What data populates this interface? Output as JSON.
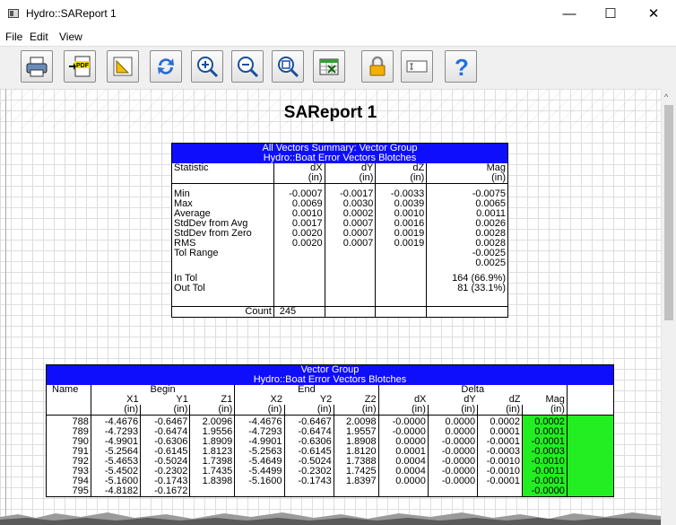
{
  "window": {
    "title": "Hydro::SAReport 1",
    "minimize": "—",
    "maximize": "☐",
    "close": "✕"
  },
  "menu": [
    "File",
    "Edit",
    "View"
  ],
  "toolbar": [
    "print-icon",
    "export-pdf-icon",
    "measure-icon",
    "refresh-icon",
    "zoom-in-icon",
    "zoom-out-icon",
    "zoom-fit-icon",
    "export-excel-icon",
    "lock-icon",
    "text-field-icon",
    "help-icon"
  ],
  "report": {
    "title": "SAReport 1"
  },
  "summary": {
    "title1": "All Vectors Summary: Vector Group",
    "title2": "Hydro::Boat Error  Vectors  Blotches",
    "headers": [
      "Statistic",
      "dX",
      "dY",
      "dZ",
      "Mag"
    ],
    "units": [
      "",
      "(in)",
      "(in)",
      "(in)",
      "(in)"
    ],
    "rows": [
      [
        "Min",
        "-0.0007",
        "-0.0017",
        "-0.0033",
        "-0.0075"
      ],
      [
        "Max",
        "0.0069",
        "0.0030",
        "0.0039",
        "0.0065"
      ],
      [
        "Average",
        "0.0010",
        "0.0002",
        "0.0010",
        "0.0011"
      ],
      [
        "StdDev from Avg",
        "0.0017",
        "0.0007",
        "0.0016",
        "0.0026"
      ],
      [
        "StdDev from Zero",
        "0.0020",
        "0.0007",
        "0.0019",
        "0.0028"
      ],
      [
        "RMS",
        "0.0020",
        "0.0007",
        "0.0019",
        "0.0028"
      ],
      [
        "Tol Range",
        "",
        "",
        "",
        "-0.0025"
      ],
      [
        "",
        "",
        "",
        "",
        "0.0025"
      ],
      [
        "In Tol",
        "",
        "",
        "",
        "164 (66.9%)"
      ],
      [
        "Out Tol",
        "",
        "",
        "",
        "81 (33.1%)"
      ]
    ],
    "count_label": "Count",
    "count_value": "245"
  },
  "vectors": {
    "title1": "Vector Group",
    "title2": "Hydro::Boat Error  Vectors  Blotches",
    "group_name": "Name",
    "groups": [
      "Begin",
      "End",
      "Delta"
    ],
    "cols": [
      "X1",
      "Y1",
      "Z1",
      "X2",
      "Y2",
      "Z2",
      "dX",
      "dY",
      "dZ",
      "Mag"
    ],
    "unit": "(in)",
    "rows": [
      [
        "788",
        "-4.4676",
        "-0.6467",
        "2.0096",
        "-4.4676",
        "-0.6467",
        "2.0098",
        "-0.0000",
        "0.0000",
        "0.0002",
        "0.0002"
      ],
      [
        "789",
        "-4.7293",
        "-0.6474",
        "1.9556",
        "-4.7293",
        "-0.6474",
        "1.9557",
        "-0.0000",
        "0.0000",
        "0.0001",
        "0.0001"
      ],
      [
        "790",
        "-4.9901",
        "-0.6306",
        "1.8909",
        "-4.9901",
        "-0.6306",
        "1.8908",
        "0.0000",
        "-0.0000",
        "-0.0001",
        "-0.0001"
      ],
      [
        "791",
        "-5.2564",
        "-0.6145",
        "1.8123",
        "-5.2563",
        "-0.6145",
        "1.8120",
        "0.0001",
        "-0.0000",
        "-0.0003",
        "-0.0003"
      ],
      [
        "792",
        "-5.4653",
        "-0.5024",
        "1.7398",
        "-5.4649",
        "-0.5024",
        "1.7388",
        "0.0004",
        "-0.0000",
        "-0.0010",
        "-0.0010"
      ],
      [
        "793",
        "-5.4502",
        "-0.2302",
        "1.7435",
        "-5.4499",
        "-0.2302",
        "1.7425",
        "0.0004",
        "-0.0000",
        "-0.0010",
        "-0.0011"
      ],
      [
        "794",
        "-5.1600",
        "-0.1743",
        "1.8398",
        "-5.1600",
        "-0.1743",
        "1.8397",
        "0.0000",
        "-0.0000",
        "-0.0001",
        "-0.0001"
      ],
      [
        "795",
        "-4.8182",
        "-0.1672",
        "",
        "",
        "",
        "",
        "",
        "",
        "",
        "-0.0000"
      ]
    ]
  },
  "colors": {
    "header_blue": "#0e0efc",
    "tol_green": "#22ee22"
  }
}
